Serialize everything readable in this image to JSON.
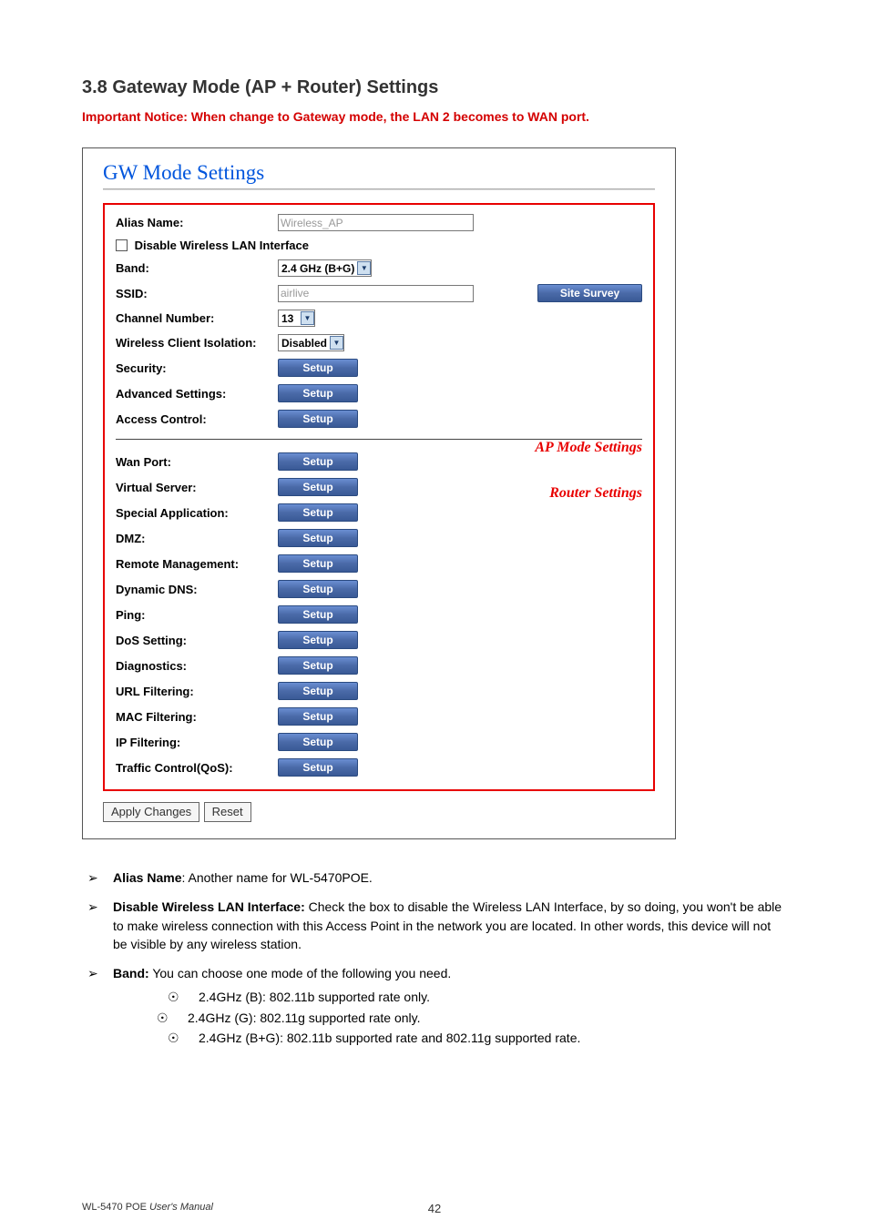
{
  "section": {
    "title": "3.8 Gateway Mode (AP + Router) Settings",
    "notice": "Important Notice: When change to Gateway mode, the LAN 2 becomes to WAN port."
  },
  "panel": {
    "title": "GW Mode Settings",
    "annotations": {
      "ap": "AP Mode Settings",
      "router": "Router Settings"
    },
    "fields": {
      "alias_label": "Alias Name:",
      "alias_value": "Wireless_AP",
      "disable_wlan_label": "Disable Wireless LAN Interface",
      "band_label": "Band:",
      "band_value": "2.4 GHz (B+G)",
      "ssid_label": "SSID:",
      "ssid_value": "airlive",
      "site_survey": "Site Survey",
      "channel_label": "Channel Number:",
      "channel_value": "13",
      "isolation_label": "Wireless Client Isolation:",
      "isolation_value": "Disabled"
    },
    "ap_rows": [
      {
        "label": "Security:",
        "btn": "Setup"
      },
      {
        "label": "Advanced Settings:",
        "btn": "Setup"
      },
      {
        "label": "Access Control:",
        "btn": "Setup"
      }
    ],
    "router_rows": [
      {
        "label": "Wan Port:",
        "btn": "Setup"
      },
      {
        "label": "Virtual Server:",
        "btn": "Setup"
      },
      {
        "label": "Special Application:",
        "btn": "Setup"
      },
      {
        "label": "DMZ:",
        "btn": "Setup"
      },
      {
        "label": "Remote Management:",
        "btn": "Setup"
      },
      {
        "label": "Dynamic DNS:",
        "btn": "Setup"
      },
      {
        "label": "Ping:",
        "btn": "Setup"
      },
      {
        "label": "DoS Setting:",
        "btn": "Setup"
      },
      {
        "label": "Diagnostics:",
        "btn": "Setup"
      },
      {
        "label": "URL Filtering:",
        "btn": "Setup"
      },
      {
        "label": "MAC Filtering:",
        "btn": "Setup"
      },
      {
        "label": "IP Filtering:",
        "btn": "Setup"
      },
      {
        "label": "Traffic Control(QoS):",
        "btn": "Setup"
      }
    ],
    "apply": "Apply Changes",
    "reset": "Reset"
  },
  "descriptions": [
    {
      "term": "Alias Name",
      "sep": ": ",
      "text": "Another name for WL-5470POE."
    },
    {
      "term": "Disable Wireless LAN Interface:",
      "sep": " ",
      "text": "Check the box to disable the Wireless LAN Interface, by so doing, you won't be able to make wireless connection with this Access Point in the network you are located. In other words, this device will not be visible by any wireless station."
    },
    {
      "term": "Band:",
      "sep": " ",
      "text": "You can choose one mode of the following you need.",
      "subs": [
        "2.4GHz (B): 802.11b supported rate only.",
        "2.4GHz (G): 802.11g supported rate only.",
        "2.4GHz (B+G): 802.11b supported rate and 802.11g supported rate."
      ]
    }
  ],
  "footer": {
    "manual_prefix": "WL-5470 POE ",
    "manual_suffix": "User's Manual",
    "page": "42"
  },
  "glyphs": {
    "arrow": "➢",
    "dot": "☉"
  }
}
